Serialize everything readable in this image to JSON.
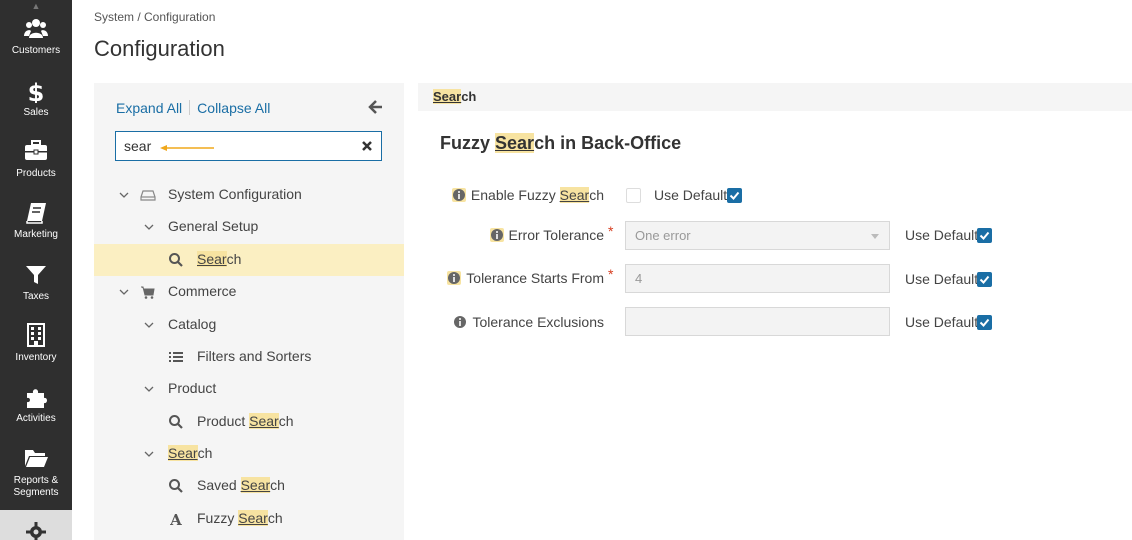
{
  "nav": {
    "items": [
      {
        "label": "Customers",
        "icon": "users-icon"
      },
      {
        "label": "Sales",
        "icon": "dollar-icon"
      },
      {
        "label": "Products",
        "icon": "briefcase-icon"
      },
      {
        "label": "Marketing",
        "icon": "book-icon"
      },
      {
        "label": "Taxes",
        "icon": "filter-icon"
      },
      {
        "label": "Inventory",
        "icon": "building-icon"
      },
      {
        "label": "Activities",
        "icon": "puzzle-icon"
      },
      {
        "label": "Reports &",
        "label2": "Segments",
        "icon": "folder-icon"
      }
    ]
  },
  "header": {
    "breadcrumb": "System / Configuration",
    "title": "Configuration"
  },
  "tree": {
    "expand_all": "Expand All",
    "collapse_all": "Collapse All",
    "search_value": "sear",
    "items": {
      "system_configuration": "System Configuration",
      "general_setup": "General Setup",
      "search_pre": "Sear",
      "search_post": "ch",
      "commerce": "Commerce",
      "catalog": "Catalog",
      "filters_and_sorters": "Filters and Sorters",
      "product": "Product",
      "product_search_pre": "Product ",
      "product_search_hl": "Sear",
      "product_search_post": "ch",
      "search2_hl": "Sear",
      "search2_post": "ch",
      "saved_search_pre": "Saved ",
      "saved_search_hl": "Sear",
      "saved_search_post": "ch",
      "fuzzy_search_pre": "Fuzzy ",
      "fuzzy_search_hl": "Sear",
      "fuzzy_search_post": "ch"
    }
  },
  "content": {
    "section_hl": "Sear",
    "section_post": "ch",
    "group_title_pre": "Fuzzy ",
    "group_title_hl": "Sear",
    "group_title_post": "ch in Back-Office",
    "fields": {
      "enable_fuzzy_pre": "Enable Fuzzy ",
      "enable_fuzzy_hl": "Sear",
      "enable_fuzzy_post": "ch",
      "enable_fuzzy_checked": false,
      "error_tolerance_label": "Error Tolerance",
      "error_tolerance_value": "One error",
      "tolerance_starts_label": "Tolerance Starts From",
      "tolerance_starts_value": "4",
      "tolerance_exclusions_label": "Tolerance Exclusions",
      "tolerance_exclusions_value": "",
      "required_mark": "*",
      "use_default": "Use Default"
    }
  },
  "colors": {
    "accent": "#1a6ea5",
    "highlight": "#f7e3a1",
    "selected_row": "#fbefc2",
    "sidebar_bg": "#2f2f2f",
    "required": "#d63d1f"
  }
}
